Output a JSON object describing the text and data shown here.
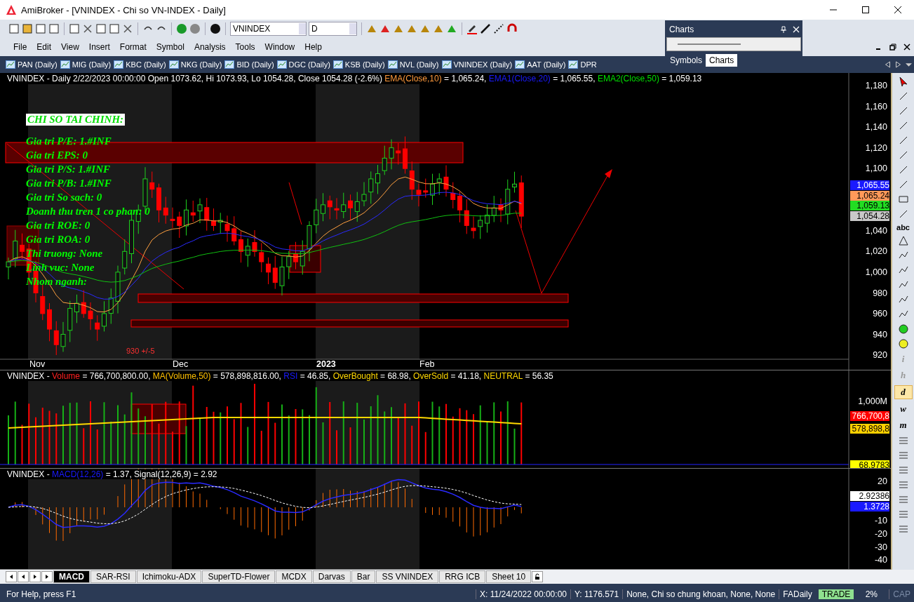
{
  "window": {
    "title": "AmiBroker - [VNINDEX - Chi so VN-INDEX - Daily]"
  },
  "toolbar": {
    "symbol": "VNINDEX",
    "interval": "D"
  },
  "menu": [
    "File",
    "Edit",
    "View",
    "Insert",
    "Format",
    "Symbol",
    "Analysis",
    "Tools",
    "Window",
    "Help"
  ],
  "symbol_tabs": [
    "PAN (Daily)",
    "MIG (Daily)",
    "KBC (Daily)",
    "NKG (Daily)",
    "BID (Daily)",
    "DGC (Daily)",
    "KSB (Daily)",
    "NVL (Daily)",
    "VNINDEX (Daily)",
    "AAT (Daily)",
    "DPR"
  ],
  "charts_panel": {
    "title": "Charts",
    "tabs": [
      {
        "label": "Symbols",
        "selected": false
      },
      {
        "label": "Charts",
        "selected": true
      }
    ]
  },
  "price_pane": {
    "header": [
      {
        "text": "VNINDEX - Daily 2/22/2023 00:00:00 Open 1073.62, Hi 1073.93, Lo 1054.28, Close 1054.28 (-2.6%) ",
        "color": "#ffffff"
      },
      {
        "text": "EMA(Close,10)",
        "color": "#ff9a3c"
      },
      {
        "text": " = 1,065.24, ",
        "color": "#ffffff"
      },
      {
        "text": "EMA1(Close,20)",
        "color": "#1a1aff"
      },
      {
        "text": " = 1,065.55, ",
        "color": "#ffffff"
      },
      {
        "text": "EMA2(Close,50)",
        "color": "#00e000"
      },
      {
        "text": " = 1,059.13",
        "color": "#ffffff"
      }
    ],
    "overlay_title": "CHI SO TAI CHINH:",
    "overlay_lines": [
      "Gia tri P/E: 1.#INF",
      "Gia tri EPS: 0",
      "Gia tri P/S: 1.#INF",
      "Gia tri P/B: 1.#INF",
      "Gia tri So sach: 0",
      "Doanh thu tren 1 co phan: 0",
      "Gia tri ROE: 0",
      "Gia tri ROA: 0",
      "Thi truong: None",
      "Linh vuc: None",
      "Nhom nganh:"
    ],
    "annotation": "930 +/-5",
    "y_ticks": [
      "1,180",
      "1,160",
      "1,140",
      "1,120",
      "1,100",
      "1,040",
      "1,020",
      "1,000",
      "980",
      "960",
      "940",
      "920"
    ],
    "x_labels": [
      "Nov",
      "Dec",
      "2023",
      "Feb"
    ],
    "price_labels": [
      {
        "text": "1,065.55",
        "color": "#1a1aff"
      },
      {
        "text": "1,065.24",
        "color": "#ff9a5a"
      },
      {
        "text": "1,059.13",
        "color": "#22dd22"
      },
      {
        "text": "1,054.28",
        "color": "#c8c8c8"
      }
    ]
  },
  "volume_pane": {
    "header": [
      {
        "text": "VNINDEX - ",
        "color": "#ffffff"
      },
      {
        "text": "Volume",
        "color": "#ff2020"
      },
      {
        "text": " = 766,700,800.00, ",
        "color": "#ffffff"
      },
      {
        "text": "MA(Volume,50)",
        "color": "#ffc000"
      },
      {
        "text": " = 578,898,816.00, ",
        "color": "#ffffff"
      },
      {
        "text": "RSI",
        "color": "#1a1aff"
      },
      {
        "text": " = 46.85, ",
        "color": "#ffffff"
      },
      {
        "text": "OverBought",
        "color": "#ffd800"
      },
      {
        "text": " = 68.98, ",
        "color": "#ffffff"
      },
      {
        "text": "OverSold",
        "color": "#ffd800"
      },
      {
        "text": " = 41.18, ",
        "color": "#ffffff"
      },
      {
        "text": "NEUTRAL",
        "color": "#ffd800"
      },
      {
        "text": " = 56.35",
        "color": "#ffffff"
      }
    ],
    "y_ticks": [
      "1,000M"
    ],
    "value_labels": [
      {
        "text": "766,700,8",
        "color": "#ff0000"
      },
      {
        "text": "578,898,8",
        "color": "#ffd000"
      },
      {
        "text": "68.9783",
        "color": "#ffff00"
      }
    ]
  },
  "macd_pane": {
    "header": [
      {
        "text": "VNINDEX - ",
        "color": "#ffffff"
      },
      {
        "text": "MACD(12,26)",
        "color": "#1a1aff"
      },
      {
        "text": " = 1.37, Signal(12,26,9) = 2.92",
        "color": "#ffffff"
      }
    ],
    "y_ticks": [
      "20",
      "-10",
      "-20",
      "-30",
      "-40"
    ],
    "value_labels": [
      {
        "text": "2.92386",
        "color": "#ffffff"
      },
      {
        "text": "1.3728",
        "color": "#1a1aff"
      }
    ]
  },
  "drawing_toolbar": {
    "text_tool": "abc",
    "intervals": [
      {
        "label": "i",
        "selected": false,
        "disabled": true
      },
      {
        "label": "h",
        "selected": false,
        "disabled": true
      },
      {
        "label": "d",
        "selected": true,
        "disabled": false
      },
      {
        "label": "w",
        "selected": false,
        "disabled": false
      },
      {
        "label": "m",
        "selected": false,
        "disabled": false
      }
    ]
  },
  "sheet_tabs": [
    {
      "label": "MACD",
      "selected": true
    },
    {
      "label": "SAR-RSI",
      "selected": false
    },
    {
      "label": "Ichimoku-ADX",
      "selected": false
    },
    {
      "label": "SuperTD-Flower",
      "selected": false
    },
    {
      "label": "MCDX",
      "selected": false
    },
    {
      "label": "Darvas",
      "selected": false
    },
    {
      "label": "Bar",
      "selected": false
    },
    {
      "label": "SS VNINDEX",
      "selected": false
    },
    {
      "label": "RRG ICB",
      "selected": false
    },
    {
      "label": "Sheet 10",
      "selected": false
    }
  ],
  "status_bar": {
    "help": "For Help, press F1",
    "x": "X: 11/24/2022 00:00:00",
    "y": "Y: 1176.571",
    "info": "None, Chi so chung khoan, None, None",
    "layout": "FADaily",
    "mode": "TRADE",
    "percent": "2%",
    "caps": "CAP"
  }
}
